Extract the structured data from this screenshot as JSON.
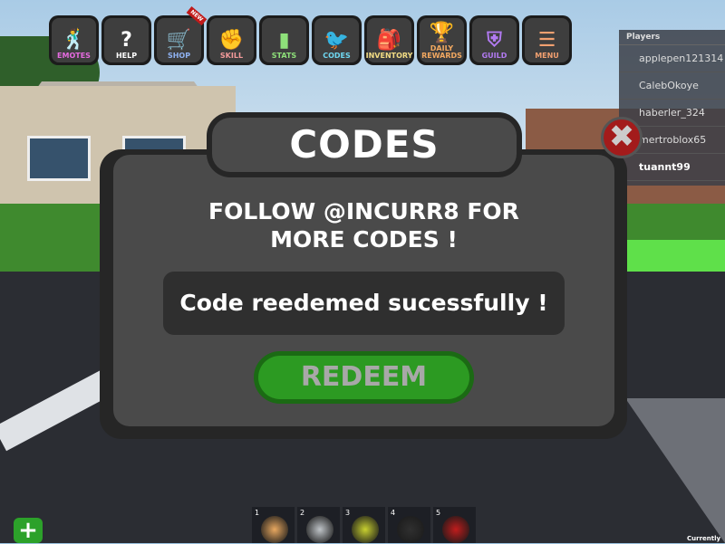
{
  "toolbar": [
    {
      "label": "EMOTES",
      "icon": "🕺",
      "color": "#e66be0"
    },
    {
      "label": "HELP",
      "icon": "?",
      "color": "#ffffff"
    },
    {
      "label": "SHOP",
      "icon": "🛒",
      "color": "#8fb2f2",
      "badge": "NEW"
    },
    {
      "label": "SKILL",
      "icon": "✊",
      "color": "#f29a9a"
    },
    {
      "label": "STATS",
      "icon": "▮",
      "color": "#8ee07a"
    },
    {
      "label": "CODES",
      "icon": "🐦",
      "color": "#6fd8f2"
    },
    {
      "label": "INVENTORY",
      "icon": "🎒",
      "color": "#f2dc84"
    },
    {
      "label": "DAILY REWARDS",
      "icon": "🏆",
      "color": "#f2a860"
    },
    {
      "label": "GUILD",
      "icon": "⛨",
      "color": "#b27af2"
    },
    {
      "label": "MENU",
      "icon": "☰",
      "color": "#f2a070"
    }
  ],
  "players": {
    "header": "Players",
    "list": [
      "applepen121314",
      "CalebOkoye",
      "haberler_324",
      "mertroblox65",
      "tuannt99"
    ]
  },
  "dialog": {
    "title": "CODES",
    "close_icon": "✖",
    "follow_line1": "FOLLOW @INCURR8 FOR",
    "follow_line2": "MORE CODES !",
    "code_value": "Code reedemed sucessfully !",
    "redeem_label": "REDEEM"
  },
  "hotbar": [
    {
      "n": "1",
      "icon": "muscle",
      "color": "#e8a860"
    },
    {
      "n": "2",
      "icon": "shield",
      "color": "#bfc4c8"
    },
    {
      "n": "3",
      "icon": "lightning",
      "color": "#c8d030"
    },
    {
      "n": "4",
      "icon": "dark-orb",
      "color": "#303030"
    },
    {
      "n": "5",
      "icon": "dumbbell",
      "color": "#c01c1c"
    }
  ],
  "plus_label": "+",
  "corner_text": "Currently"
}
